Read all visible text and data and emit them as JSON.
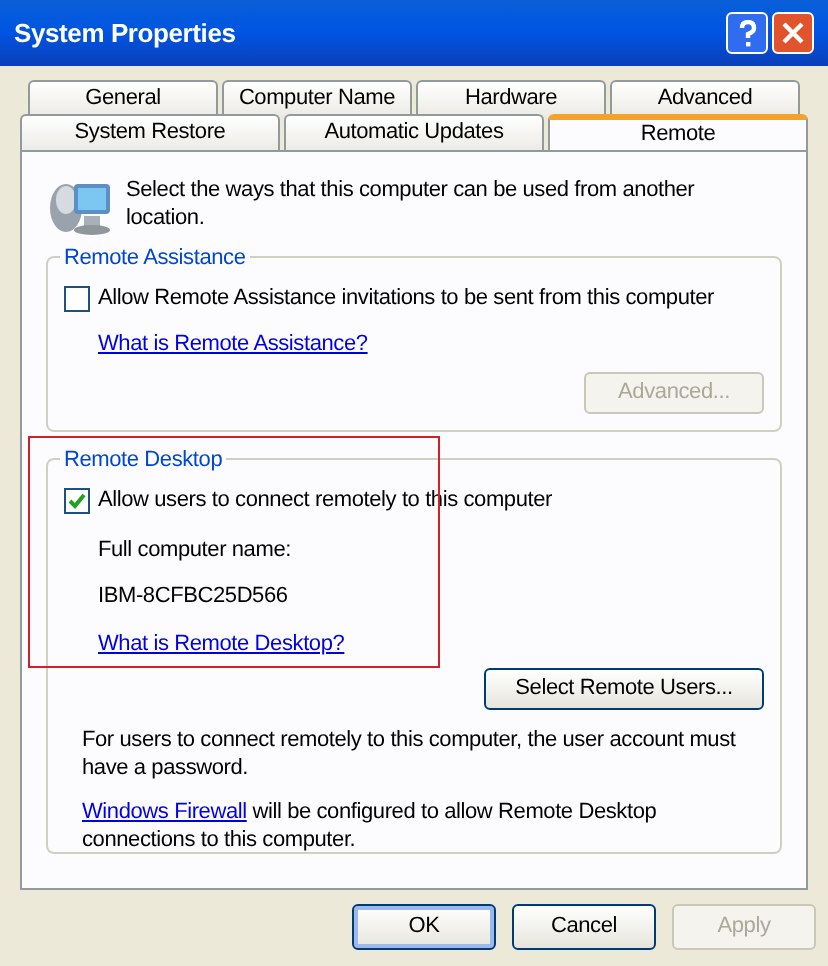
{
  "window": {
    "title": "System Properties"
  },
  "tab_rows": [
    [
      {
        "label": "General",
        "selected": false
      },
      {
        "label": "Computer Name",
        "selected": false
      },
      {
        "label": "Hardware",
        "selected": false
      },
      {
        "label": "Advanced",
        "selected": false
      }
    ],
    [
      {
        "label": "System Restore",
        "selected": false
      },
      {
        "label": "Automatic Updates",
        "selected": false
      },
      {
        "label": "Remote",
        "selected": true
      }
    ]
  ],
  "intro": "Select the ways that this computer can be used from another location.",
  "remote_assistance": {
    "title": "Remote Assistance",
    "checkbox": {
      "label": "Allow Remote Assistance invitations to be sent from this computer",
      "checked": false
    },
    "link": "What is Remote Assistance?",
    "button": {
      "label": "Advanced...",
      "disabled": true
    }
  },
  "remote_desktop": {
    "title": "Remote Desktop",
    "checkbox": {
      "label": "Allow users to connect remotely to this computer",
      "checked": true
    },
    "name_label": "Full computer name:",
    "computer_name": "IBM-8CFBC25D566",
    "link": "What is Remote Desktop?",
    "button": {
      "label": "Select Remote Users...",
      "disabled": false
    },
    "note": "For users to connect remotely to this computer, the user account must have a password.",
    "firewall_link": "Windows Firewall",
    "firewall_text": "will be configured to allow Remote Desktop connections to this computer."
  },
  "buttons": [
    {
      "label": "OK",
      "disabled": false,
      "default": true
    },
    {
      "label": "Cancel",
      "disabled": false,
      "default": false
    },
    {
      "label": "Apply",
      "disabled": true,
      "default": false
    }
  ]
}
